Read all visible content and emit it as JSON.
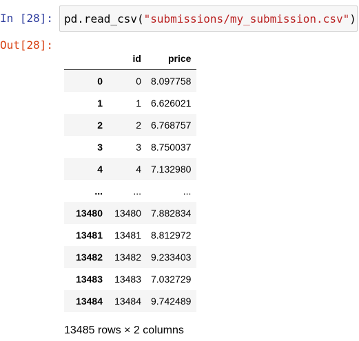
{
  "cell": {
    "in_prompt": "In [28]:",
    "out_prompt": "Out[28]:",
    "code_func": "pd.read_csv(",
    "code_arg": "\"submissions/my_submission.csv\"",
    "code_close": ")"
  },
  "dataframe": {
    "columns": [
      "id",
      "price"
    ],
    "rows": [
      {
        "index": "0",
        "id": "0",
        "price": "8.097758"
      },
      {
        "index": "1",
        "id": "1",
        "price": "6.626021"
      },
      {
        "index": "2",
        "id": "2",
        "price": "6.768757"
      },
      {
        "index": "3",
        "id": "3",
        "price": "8.750037"
      },
      {
        "index": "4",
        "id": "4",
        "price": "7.132980"
      },
      {
        "index": "...",
        "id": "...",
        "price": "..."
      },
      {
        "index": "13480",
        "id": "13480",
        "price": "7.882834"
      },
      {
        "index": "13481",
        "id": "13481",
        "price": "8.812972"
      },
      {
        "index": "13482",
        "id": "13482",
        "price": "9.233403"
      },
      {
        "index": "13483",
        "id": "13483",
        "price": "7.032729"
      },
      {
        "index": "13484",
        "id": "13484",
        "price": "9.742489"
      }
    ],
    "shape_text": "13485 rows × 2 columns"
  }
}
